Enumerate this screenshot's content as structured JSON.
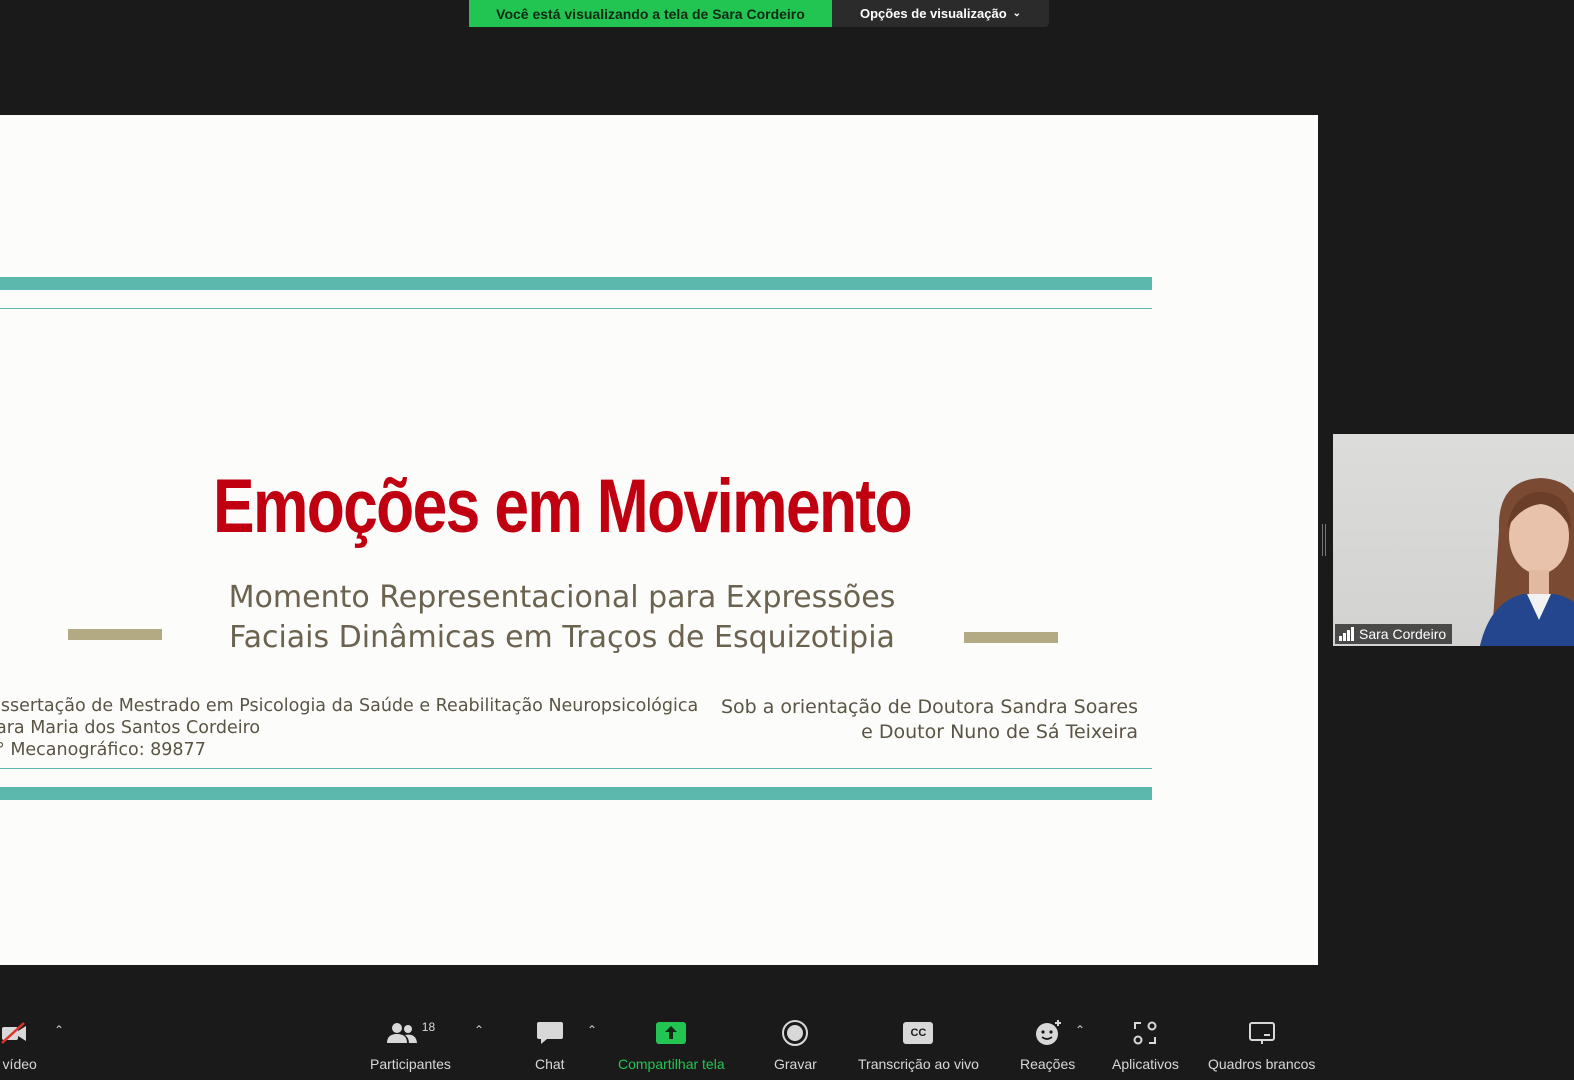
{
  "banner": {
    "viewing_text": "Você está visualizando a tela de Sara Cordeiro",
    "view_options_label": "Opções de visualização",
    "accent": "#23c552"
  },
  "slide": {
    "title": "Emoções em Movimento",
    "subtitle_line1": "Momento Representacional para Expressões",
    "subtitle_line2": "Faciais Dinâmicas em Traços de Esquizotipia",
    "left_line1": "issertação de Mestrado em Psicologia da Saúde e Reabilitação Neuropsicológica",
    "left_line2": "ara Maria dos Santos Cordeiro",
    "left_line3": "° Mecanográfico: 89877",
    "right_line1": "Sob a orientação de Doutora Sandra Soares",
    "right_line2": "e Doutor Nuno de Sá Teixeira",
    "title_color": "#c00010",
    "band_color": "#5cb8ad"
  },
  "participant": {
    "name": "Sara Cordeiro",
    "signal_icon": "signal-bars-icon"
  },
  "toolbar": {
    "video_label": "r vídeo",
    "participants_label": "Participantes",
    "participants_count": "18",
    "chat_label": "Chat",
    "share_label": "Compartilhar tela",
    "record_label": "Gravar",
    "transcription_label": "Transcrição ao vivo",
    "cc_text": "CC",
    "reactions_label": "Reações",
    "apps_label": "Aplicativos",
    "whiteboards_label": "Quadros brancos"
  }
}
